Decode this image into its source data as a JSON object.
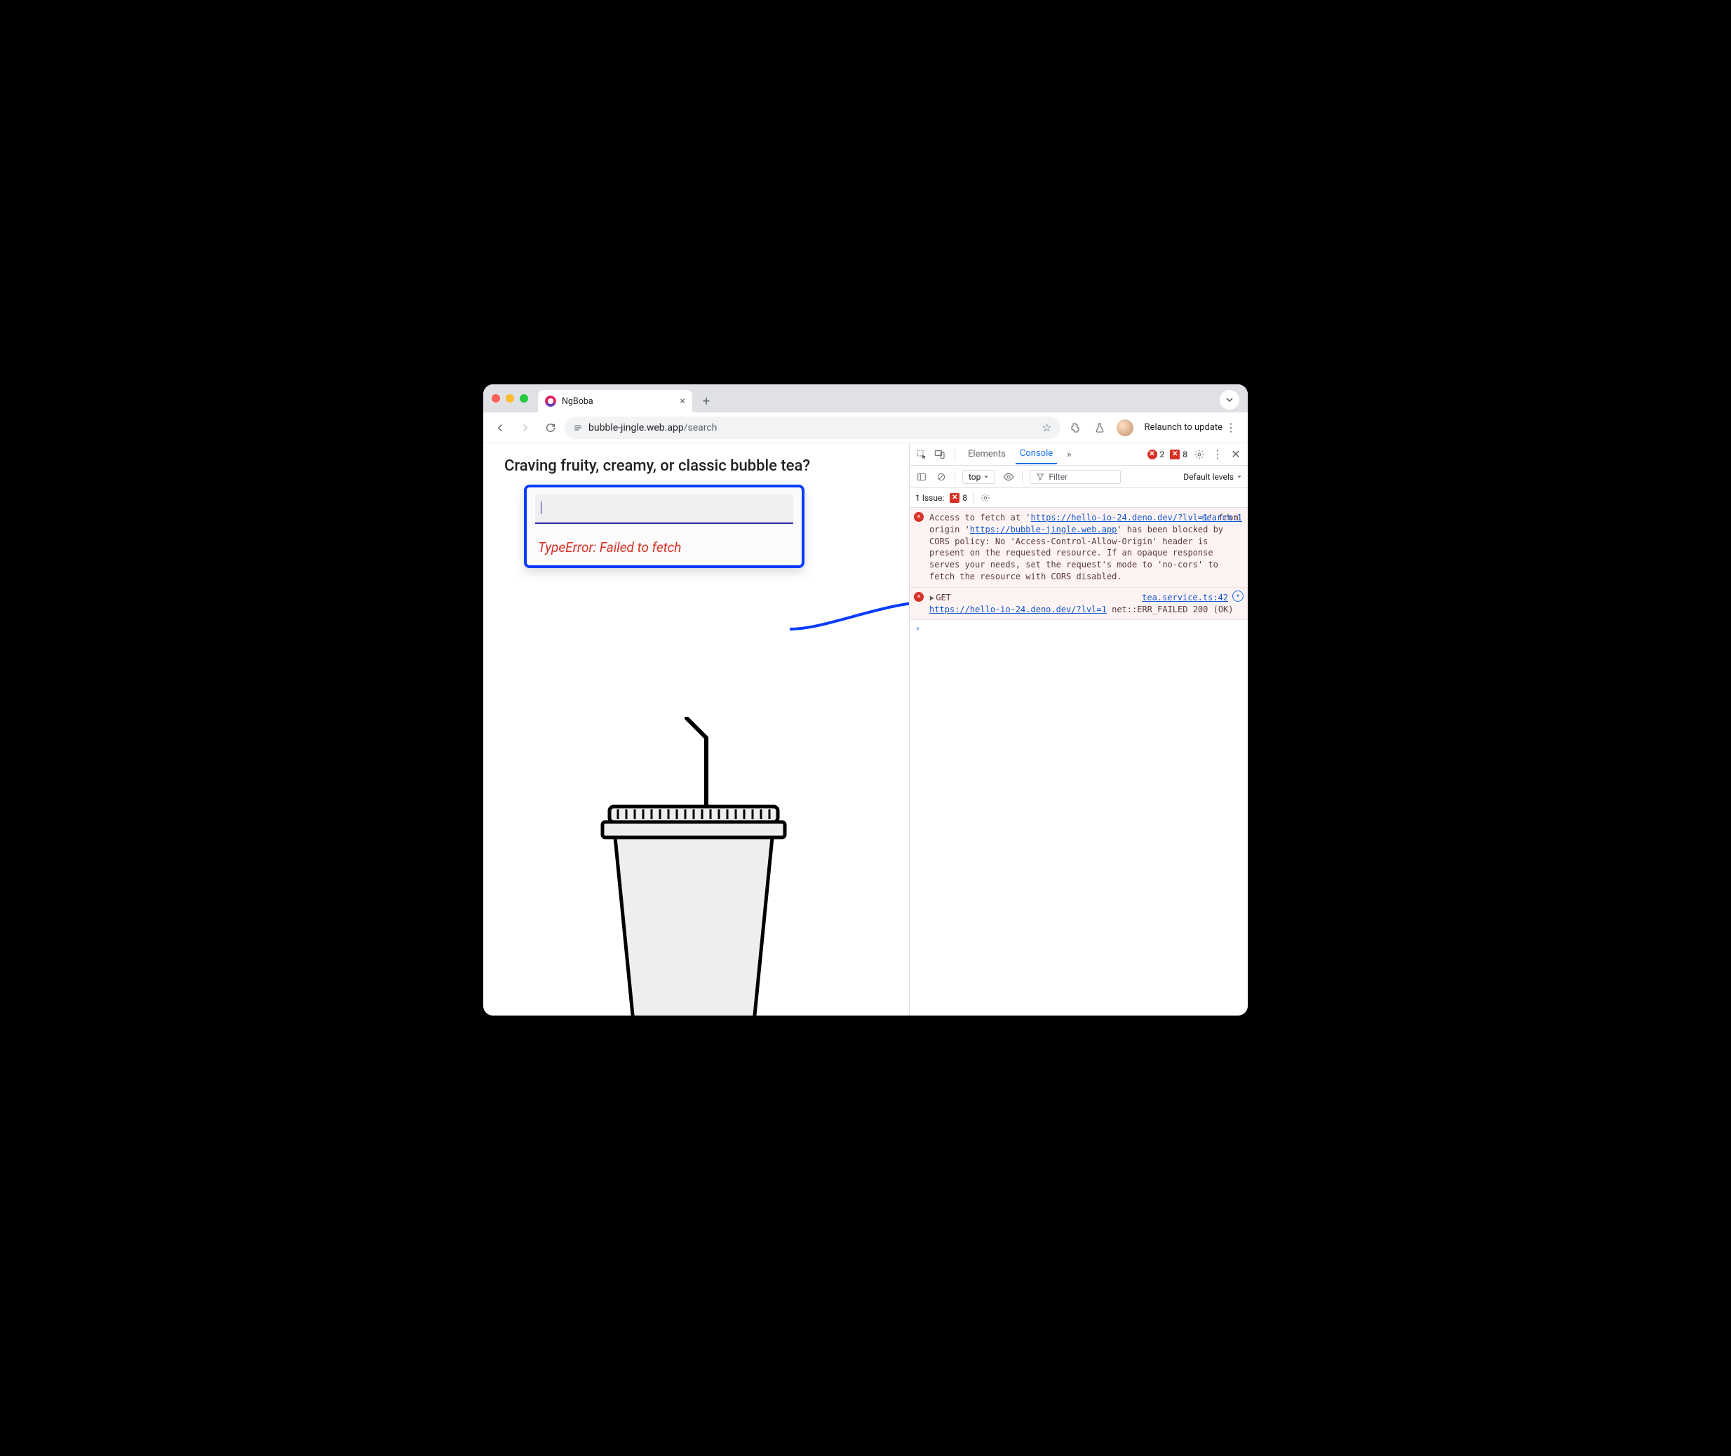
{
  "browser": {
    "tab": {
      "title": "NgBoba"
    },
    "url": {
      "host": "bubble-jingle.web.app",
      "path": "/search"
    },
    "relaunch_label": "Relaunch to update"
  },
  "page": {
    "heading": "Craving fruity, creamy, or classic bubble tea?",
    "search_value": "",
    "error_text": "TypeError: Failed to fetch"
  },
  "devtools": {
    "tabs": {
      "elements": "Elements",
      "console": "Console"
    },
    "error_badge": {
      "count": "2"
    },
    "warning_badge": {
      "count": "8"
    },
    "top_label": "top",
    "filter_placeholder": "Filter",
    "levels_label": "Default levels",
    "issue_label": "1 Issue:",
    "issue_count": "8",
    "log1": {
      "source_link": "search:1",
      "t1": "Access to fetch at '",
      "url1": "https://hello-io-24.deno.dev/?lvl=1",
      "t2": "' from origin '",
      "url2": "https://bubble-jingle.web.app",
      "t3": "' has been blocked by CORS policy: No 'Access-Control-Allow-Origin' header is present on the requested resource. If an opaque response serves your needs, set the request's mode to 'no-cors' to fetch the resource with CORS disabled."
    },
    "log2": {
      "source_link": "tea.service.ts:42",
      "method": "GET",
      "url": "https://hello-io-24.deno.dev/?lvl=1",
      "tail": " net::ERR_FAILED 200 (OK)"
    }
  }
}
